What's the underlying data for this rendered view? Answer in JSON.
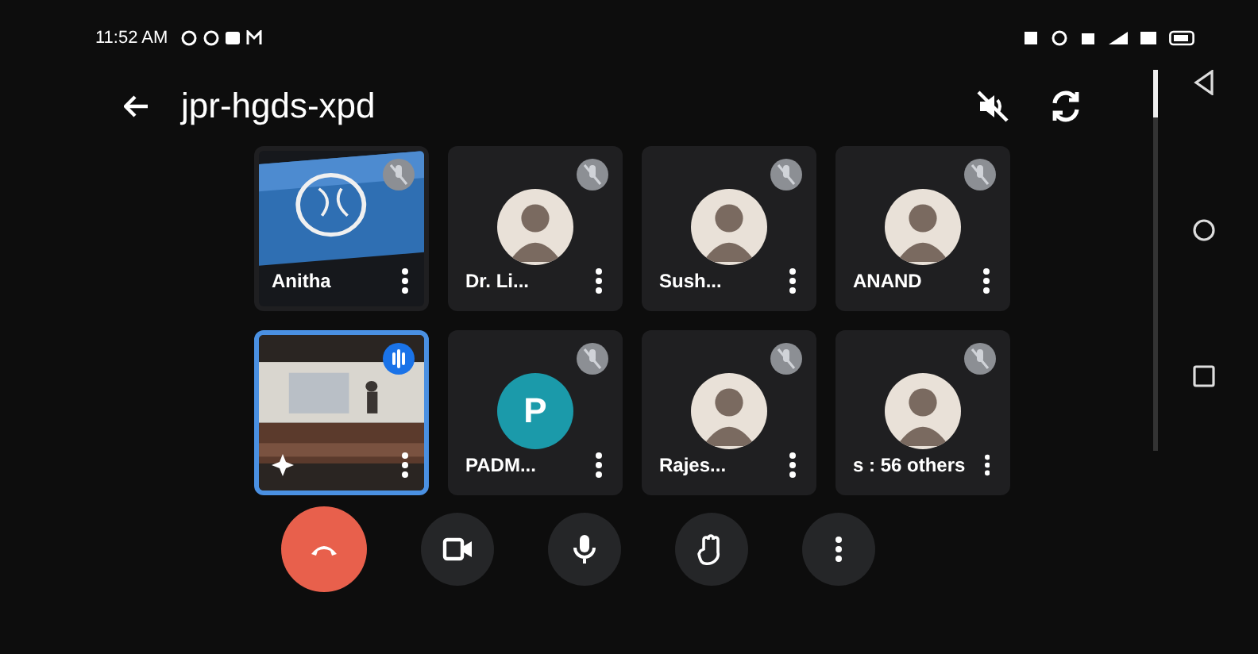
{
  "status_bar": {
    "time": "11:52 AM"
  },
  "top_bar": {
    "title": "jpr-hgds-xpd"
  },
  "tiles": [
    {
      "name": "Anitha",
      "kind": "picture",
      "muted": true,
      "speaking": false
    },
    {
      "name": "Dr. Li...",
      "muted": true,
      "speaking": false
    },
    {
      "name": "Sush...",
      "muted": true,
      "speaking": false
    },
    {
      "name": "ANAND",
      "muted": true,
      "speaking": false
    },
    {
      "kind": "self",
      "muted": false,
      "speaking": true
    },
    {
      "name": "PADM...",
      "kind": "letter",
      "letter": "P",
      "muted": true,
      "speaking": false
    },
    {
      "name": "Rajes...",
      "muted": true,
      "speaking": false
    },
    {
      "name": "s : 56 others",
      "muted": true,
      "speaking": false
    }
  ],
  "controls": [
    {
      "kind": "end-call"
    },
    {
      "kind": "camera"
    },
    {
      "kind": "mic"
    },
    {
      "kind": "hand"
    },
    {
      "kind": "more"
    }
  ]
}
